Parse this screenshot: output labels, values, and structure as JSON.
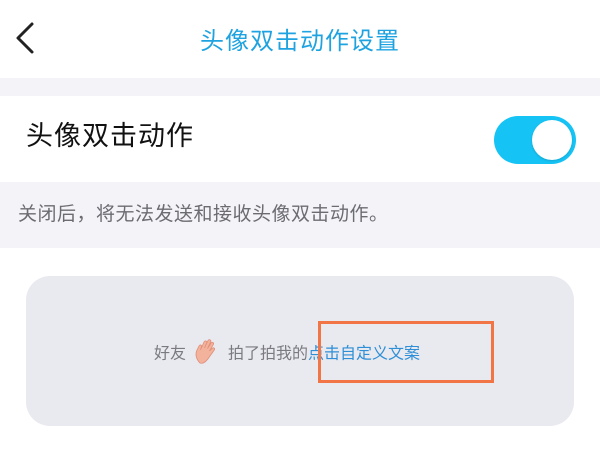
{
  "header": {
    "title": "头像双击动作设置",
    "back_icon": "chevron-left-icon"
  },
  "setting": {
    "label": "头像双击动作",
    "toggle_on": true,
    "toggle_color": "#16c3f5"
  },
  "description": "关闭后，将无法发送和接收头像双击动作。",
  "preview": {
    "prefix": "好友",
    "icon": "waving-hand-icon",
    "middle": "拍了拍我的",
    "link": "点击自定义文案"
  },
  "colors": {
    "title": "#1fa3e0",
    "link": "#2f8fd6",
    "highlight": "#f27545"
  }
}
